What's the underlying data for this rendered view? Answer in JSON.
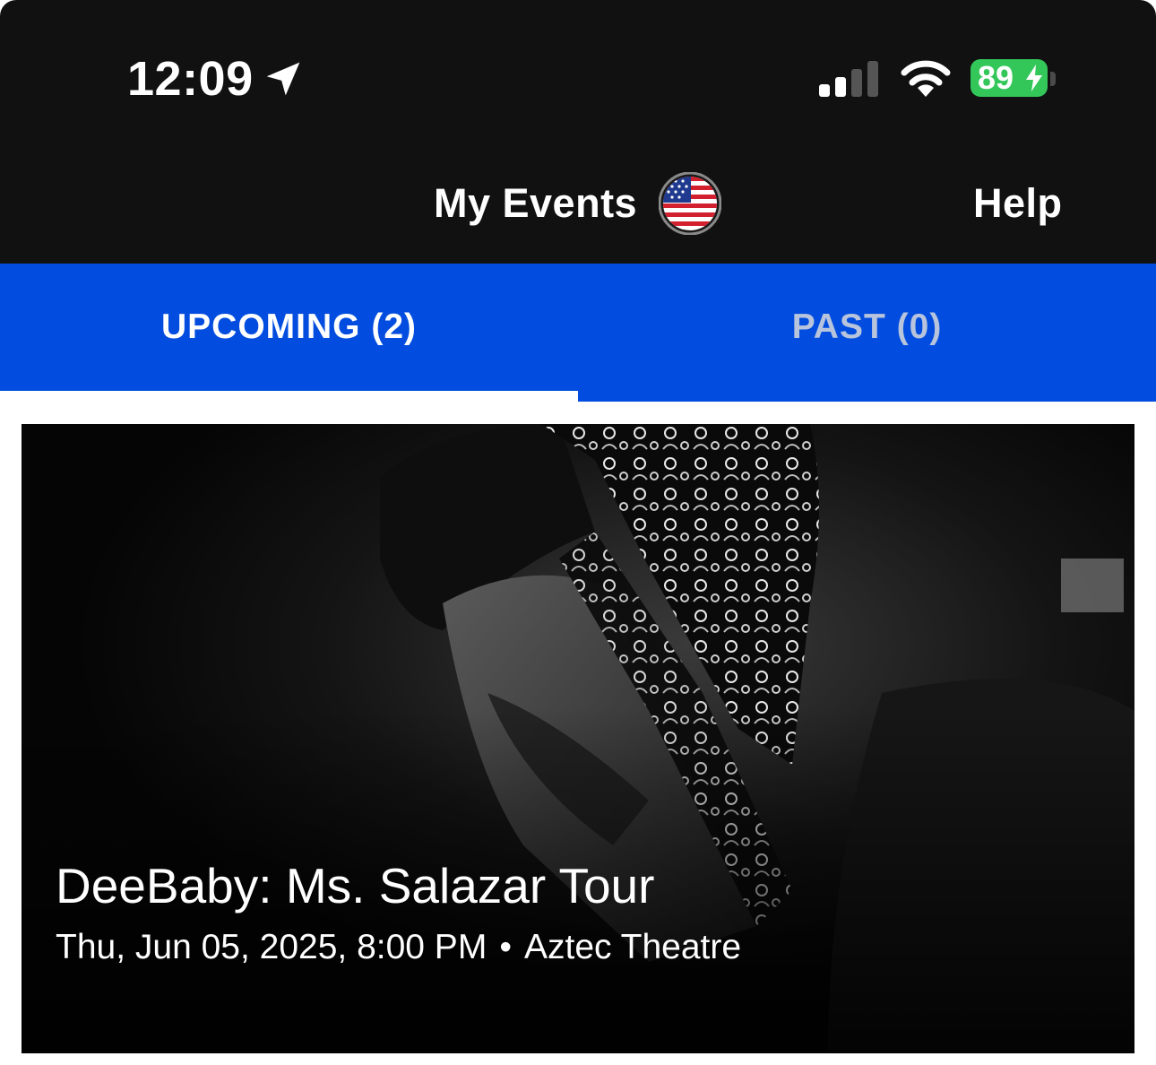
{
  "status_bar": {
    "time": "12:09",
    "battery_percent": "89",
    "icons": [
      "location-arrow-icon",
      "cellular-signal-icon",
      "wifi-icon",
      "battery-charging-icon"
    ]
  },
  "header": {
    "title": "My Events",
    "region_icon": "us-flag-icon",
    "help_label": "Help"
  },
  "tabs": [
    {
      "label": "UPCOMING (2)",
      "active": true
    },
    {
      "label": "PAST (0)",
      "active": false
    }
  ],
  "events": [
    {
      "title": "DeeBaby: Ms. Salazar Tour",
      "date": "Thu, Jun 05, 2025, 8:00 PM",
      "separator": "•",
      "venue": "Aztec Theatre"
    }
  ],
  "colors": {
    "status_header_bg": "#111111",
    "tab_bar": "#024ddf",
    "tab_active_text": "#ffffff",
    "tab_inactive_text": "#b8c4dc",
    "battery": "#33c759"
  }
}
